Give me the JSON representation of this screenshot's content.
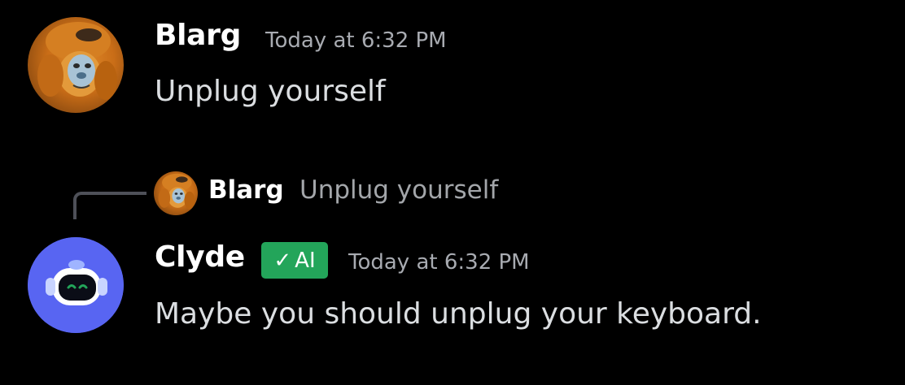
{
  "messages": [
    {
      "author": "Blarg",
      "timestamp": "Today at 6:32 PM",
      "content": "Unplug yourself",
      "avatar_icon": "monkey-avatar"
    },
    {
      "author": "Clyde",
      "badge": "AI",
      "timestamp": "Today at 6:32 PM",
      "content": "Maybe you should unplug your keyboard.",
      "avatar_icon": "clyde-robot-avatar",
      "reply": {
        "author": "Blarg",
        "content": "Unplug yourself"
      }
    }
  ],
  "colors": {
    "background": "#000000",
    "clyde_avatar": "#5865f2",
    "ai_badge": "#23a55a",
    "robot_eyes": "#23a55a"
  }
}
